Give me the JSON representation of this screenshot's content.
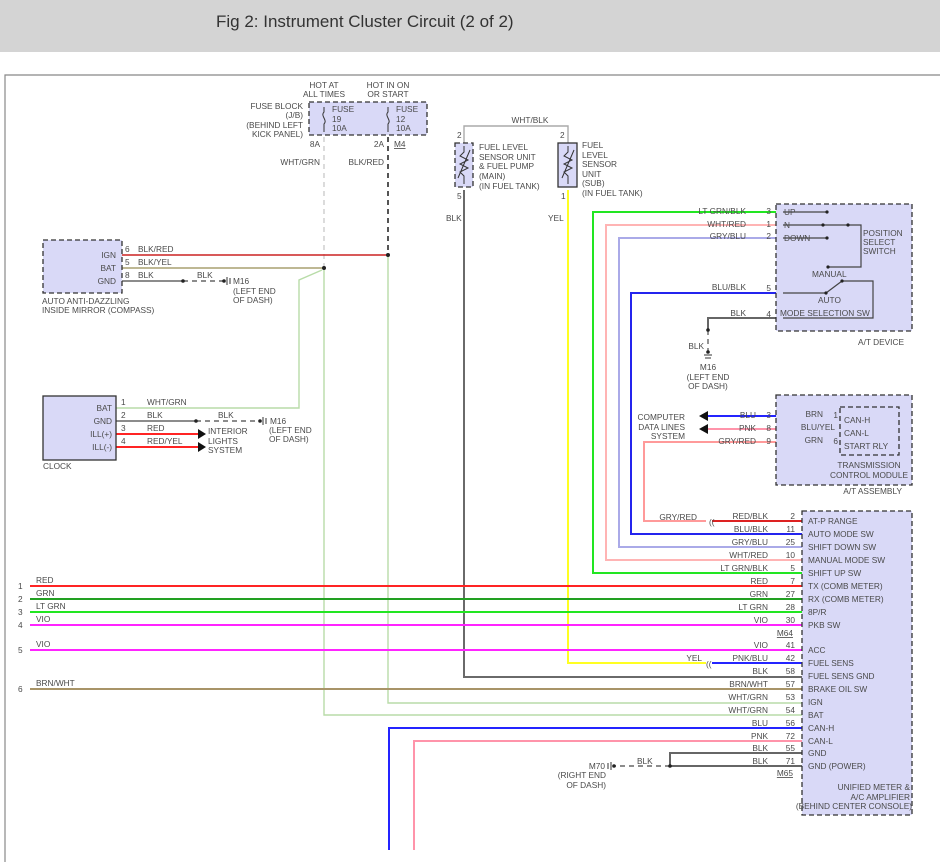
{
  "header": {
    "title": "Fig 2: Instrument Cluster Circuit (2 of 2)"
  },
  "fuse_block": {
    "label": [
      "FUSE BLOCK",
      "(J/B)",
      "(BEHIND LEFT",
      "KICK PANEL)"
    ],
    "hot1": [
      "HOT AT",
      "ALL TIMES"
    ],
    "hot2": [
      "HOT IN ON",
      "OR START"
    ],
    "fuse1": [
      "FUSE",
      "19",
      "10A"
    ],
    "fuse2": [
      "FUSE",
      "12",
      "10A"
    ],
    "pin1": "8A",
    "pin2": "2A",
    "connector": "M4",
    "wire1": "WHT/GRN",
    "wire2": "BLK/RED"
  },
  "fuel": {
    "wire_top": "WHT/BLK",
    "main": {
      "pin_top": "2",
      "pin_bottom": "5",
      "wire": "BLK",
      "label": [
        "FUEL LEVEL",
        "SENSOR UNIT",
        "& FUEL PUMP",
        "(MAIN)",
        "(IN FUEL TANK)"
      ]
    },
    "sub": {
      "pin_top": "2",
      "pin_bottom": "1",
      "wire": "YEL",
      "label": [
        "FUEL",
        "LEVEL",
        "SENSOR",
        "UNIT",
        "(SUB)",
        "(IN FUEL TANK)"
      ]
    }
  },
  "at_device": {
    "pins": [
      {
        "num": "3",
        "wire": "LT GRN/BLK",
        "name": "UP"
      },
      {
        "num": "1",
        "wire": "WHT/RED",
        "name": "N"
      },
      {
        "num": "2",
        "wire": "GRY/BLU",
        "name": "DOWN"
      },
      {
        "num": "5",
        "wire": "BLU/BLK",
        "name": ""
      },
      {
        "num": "4",
        "wire": "BLK",
        "name": "MODE SELECTION SW"
      }
    ],
    "position_switch": [
      "POSITION",
      "SELECT",
      "SWITCH"
    ],
    "manual": "MANUAL",
    "auto": "AUTO",
    "title": "A/T DEVICE",
    "ground": {
      "wire": "BLK",
      "connector": "M16",
      "location": [
        "(LEFT END",
        "OF DASH)"
      ]
    }
  },
  "at_assembly": {
    "pins": [
      {
        "num": "3",
        "wire": "BLU",
        "inner_wire": "BRN",
        "inner_num": "1",
        "name": "CAN-H"
      },
      {
        "num": "8",
        "wire": "PNK",
        "inner_wire": "BLU/YEL",
        "inner_num": "2",
        "name": "CAN-L"
      },
      {
        "num": "9",
        "wire": "GRY/RED",
        "inner_wire": "GRN",
        "inner_num": "6",
        "name": "START RLY"
      }
    ],
    "computer": [
      "COMPUTER",
      "DATA LINES",
      "SYSTEM"
    ],
    "tcm": [
      "TRANSMISSION",
      "CONTROL MODULE"
    ],
    "title": "A/T ASSEMBLY"
  },
  "meter": {
    "pins": [
      {
        "wire": "RED/BLK",
        "num": "2",
        "name": "AT-P RANGE"
      },
      {
        "wire": "BLU/BLK",
        "num": "11",
        "name": "AUTO MODE SW"
      },
      {
        "wire": "GRY/BLU",
        "num": "25",
        "name": "SHIFT DOWN SW"
      },
      {
        "wire": "WHT/RED",
        "num": "10",
        "name": "MANUAL MODE SW"
      },
      {
        "wire": "LT GRN/BLK",
        "num": "5",
        "name": "SHIFT UP SW"
      },
      {
        "wire": "RED",
        "num": "7",
        "name": "TX (COMB METER)"
      },
      {
        "wire": "GRN",
        "num": "27",
        "name": "RX (COMB METER)"
      },
      {
        "wire": "LT GRN",
        "num": "28",
        "name": "8P/R"
      },
      {
        "wire": "VIO",
        "num": "30",
        "name": "PKB SW"
      },
      {
        "wire": "VIO",
        "num": "41",
        "name": "ACC"
      },
      {
        "wire": "PNK/BLU",
        "num": "42",
        "name": "FUEL SENS"
      },
      {
        "wire": "BLK",
        "num": "58",
        "name": "FUEL SENS GND"
      },
      {
        "wire": "BRN/WHT",
        "num": "57",
        "name": "BRAKE OIL SW"
      },
      {
        "wire": "WHT/GRN",
        "num": "53",
        "name": "IGN"
      },
      {
        "wire": "WHT/GRN",
        "num": "54",
        "name": "BAT"
      },
      {
        "wire": "BLU",
        "num": "56",
        "name": "CAN-H"
      },
      {
        "wire": "PNK",
        "num": "72",
        "name": "CAN-L"
      },
      {
        "wire": "BLK",
        "num": "55",
        "name": "GND"
      },
      {
        "wire": "BLK",
        "num": "71",
        "name": "GND (POWER)"
      }
    ],
    "connector1": "M64",
    "connector2": "M65",
    "title": [
      "UNIFIED METER &",
      "A/C AMPLIFIER",
      "(BEHIND CENTER CONSOLE)"
    ],
    "inline_gry_red": "GRY/RED",
    "inline_yel": "YEL",
    "ground": {
      "wire": "BLK",
      "connector": "M70",
      "location": [
        "(RIGHT END",
        "OF DASH)"
      ]
    }
  },
  "mirror": {
    "pins": [
      {
        "name": "IGN",
        "num": "6",
        "wire": "BLK/RED"
      },
      {
        "name": "BAT",
        "num": "5",
        "wire": "BLK/YEL"
      },
      {
        "name": "GND",
        "num": "8",
        "wire": "BLK"
      }
    ],
    "ground": {
      "wire": "BLK",
      "connector": "M16",
      "location": [
        "(LEFT END",
        "OF DASH)"
      ]
    },
    "title": [
      "AUTO ANTI-DAZZLING",
      "INSIDE MIRROR (COMPASS)"
    ]
  },
  "clock": {
    "pins": [
      {
        "name": "BAT",
        "num": "1",
        "wire": "WHT/GRN"
      },
      {
        "name": "GND",
        "num": "2",
        "wire": "BLK"
      },
      {
        "name": "ILL(+)",
        "num": "3",
        "wire": "RED"
      },
      {
        "name": "ILL(-)",
        "num": "4",
        "wire": "RED/YEL"
      }
    ],
    "ground": {
      "wire": "BLK",
      "connector": "M16",
      "location": [
        "(LEFT END",
        "OF DASH)"
      ]
    },
    "interior": [
      "INTERIOR",
      "LIGHTS",
      "SYSTEM"
    ],
    "title": "CLOCK"
  },
  "harness": [
    {
      "num": "1",
      "wire": "RED"
    },
    {
      "num": "2",
      "wire": "GRN"
    },
    {
      "num": "3",
      "wire": "LT GRN"
    },
    {
      "num": "4",
      "wire": "VIO"
    },
    {
      "num": "5",
      "wire": "VIO"
    },
    {
      "num": "6",
      "wire": "BRN/WHT"
    }
  ],
  "colors": {
    "component_fill": "#d9d9f7",
    "red": "#ff2424",
    "green": "#22a022",
    "lt_green": "#22e622",
    "violet": "#ff24ff",
    "brown_white": "#a89468",
    "white_green": "#b8dca8",
    "blue": "#2424ff",
    "pink": "#ff94aa",
    "black": "#6a6a6a",
    "yellow": "#ffff22"
  }
}
